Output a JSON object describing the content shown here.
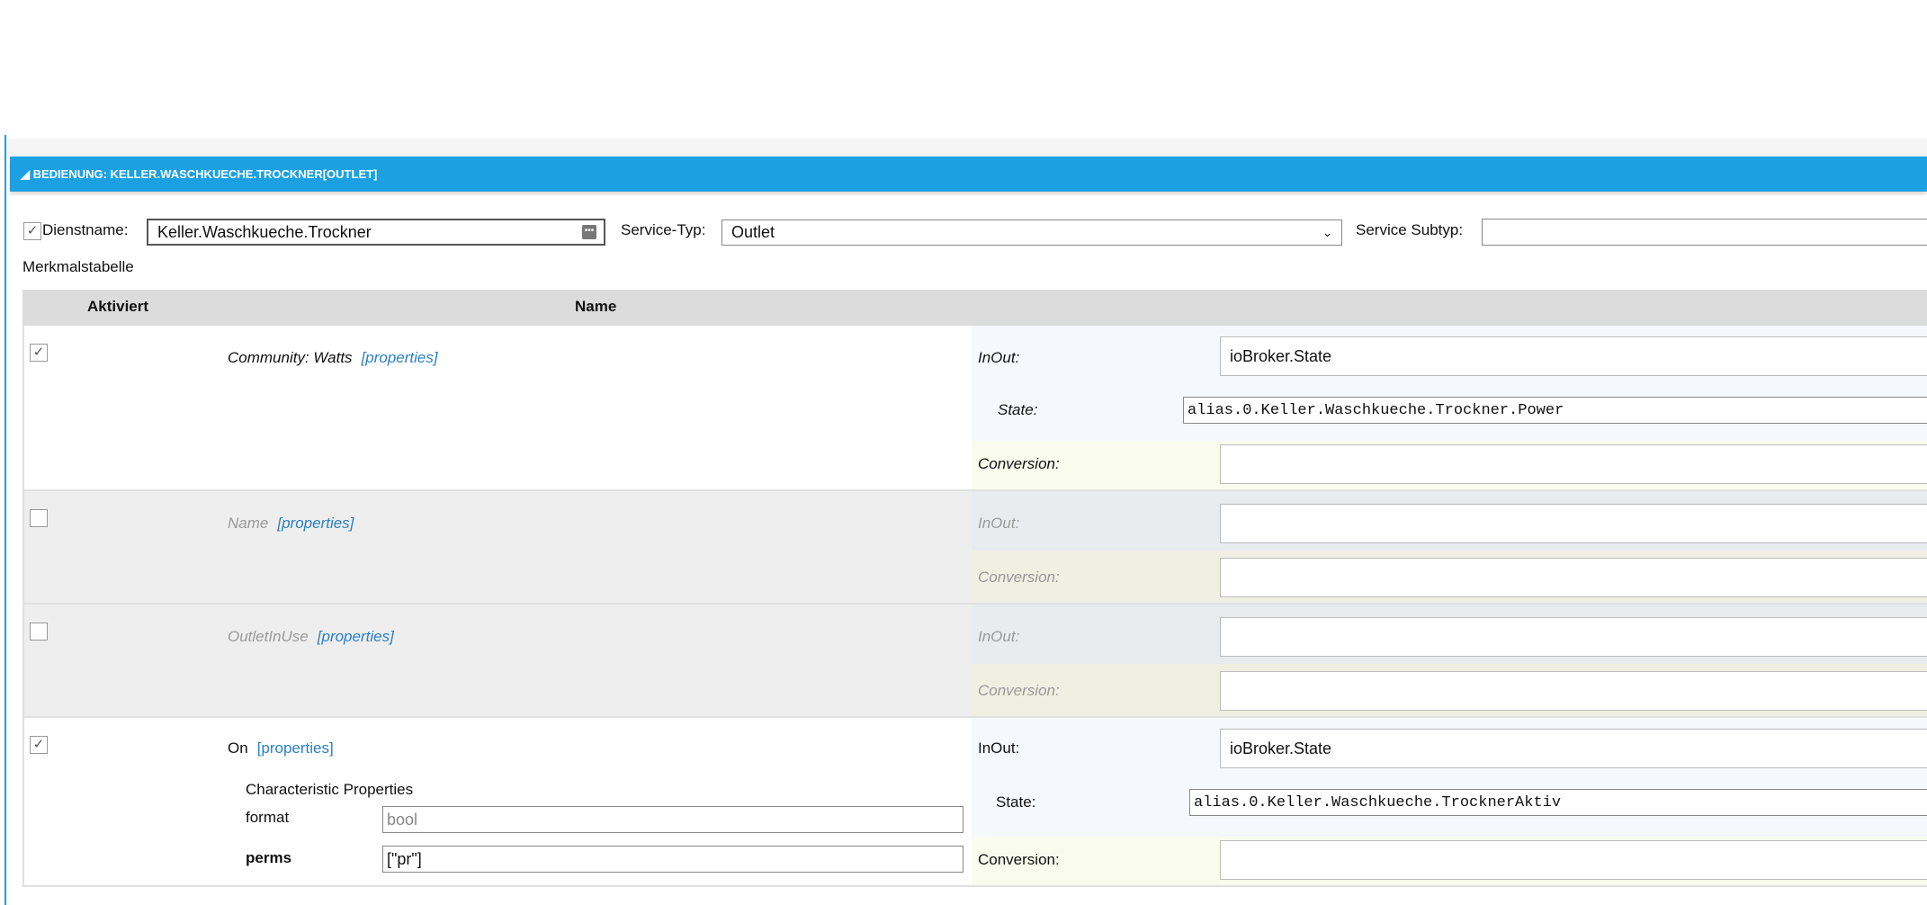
{
  "header": {
    "title": "BEDIENUNG: KELLER.WASCHKUECHE.TROCKNER[OUTLET]"
  },
  "service": {
    "name_label": "Dienstname:",
    "name_value": "Keller.Waschkueche.Trockner",
    "type_label": "Service-Typ:",
    "type_value": "Outlet",
    "subtype_label": "Service Subtyp:",
    "subtype_value": ""
  },
  "table": {
    "title": "Merkmalstabelle",
    "col_enabled": "Aktiviert",
    "col_name": "Name"
  },
  "labels": {
    "inout": "InOut:",
    "state": "State:",
    "conversion": "Conversion:",
    "properties": "[properties]",
    "char_props": "Characteristic Properties"
  },
  "rows": [
    {
      "name": "Community: Watts",
      "enabled": true,
      "inout": "ioBroker.State",
      "state": "alias.0.Keller.Waschkueche.Trockner.Power",
      "conversion": ""
    },
    {
      "name": "Name",
      "enabled": false,
      "inout": "",
      "conversion": ""
    },
    {
      "name": "OutletInUse",
      "enabled": false,
      "inout": "",
      "conversion": ""
    },
    {
      "name": "On",
      "enabled": true,
      "inout": "ioBroker.State",
      "state": "alias.0.Keller.Waschkueche.TrocknerAktiv",
      "conversion": "",
      "props": [
        {
          "key": "format",
          "value": "bool"
        },
        {
          "key": "perms",
          "value": "[\"pr\"]"
        }
      ]
    }
  ]
}
